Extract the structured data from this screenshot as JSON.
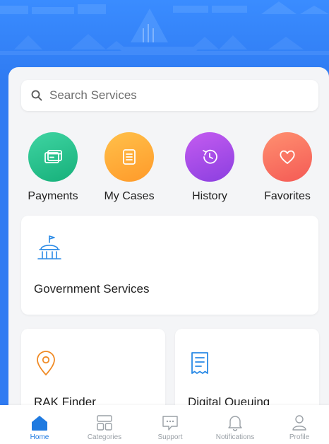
{
  "search": {
    "placeholder": "Search Services"
  },
  "quick_actions": [
    {
      "label": "Payments",
      "icon": "credit-card-icon",
      "color_from": "#3fd4a2",
      "color_to": "#16b07a"
    },
    {
      "label": "My Cases",
      "icon": "document-icon",
      "color_from": "#ffc04a",
      "color_to": "#ff9a2a"
    },
    {
      "label": "History",
      "icon": "history-clock-icon",
      "color_from": "#c45cf0",
      "color_to": "#8b3fe0"
    },
    {
      "label": "Favorites",
      "icon": "heart-icon",
      "color_from": "#ff9070",
      "color_to": "#f45a55"
    }
  ],
  "cards": {
    "government": {
      "title": "Government Services",
      "icon": "government-building-icon"
    },
    "finder": {
      "title": "RAK Finder",
      "icon": "location-pin-icon"
    },
    "queuing": {
      "title": "Digital Queuing",
      "icon": "receipt-ticket-icon"
    }
  },
  "tabbar": {
    "items": [
      {
        "label": "Home",
        "icon": "home-icon",
        "active": true
      },
      {
        "label": "Categories",
        "icon": "categories-icon",
        "active": false
      },
      {
        "label": "Support",
        "icon": "chat-support-icon",
        "active": false
      },
      {
        "label": "Notifications",
        "icon": "bell-icon",
        "active": false
      },
      {
        "label": "Profile",
        "icon": "profile-icon",
        "active": false
      }
    ]
  },
  "colors": {
    "brand_blue": "#2f7bf2",
    "active_tab": "#1f7ae0",
    "icon_blue": "#2a8ae6",
    "icon_orange": "#f08a24",
    "inactive_tab": "#9aa0a6"
  }
}
